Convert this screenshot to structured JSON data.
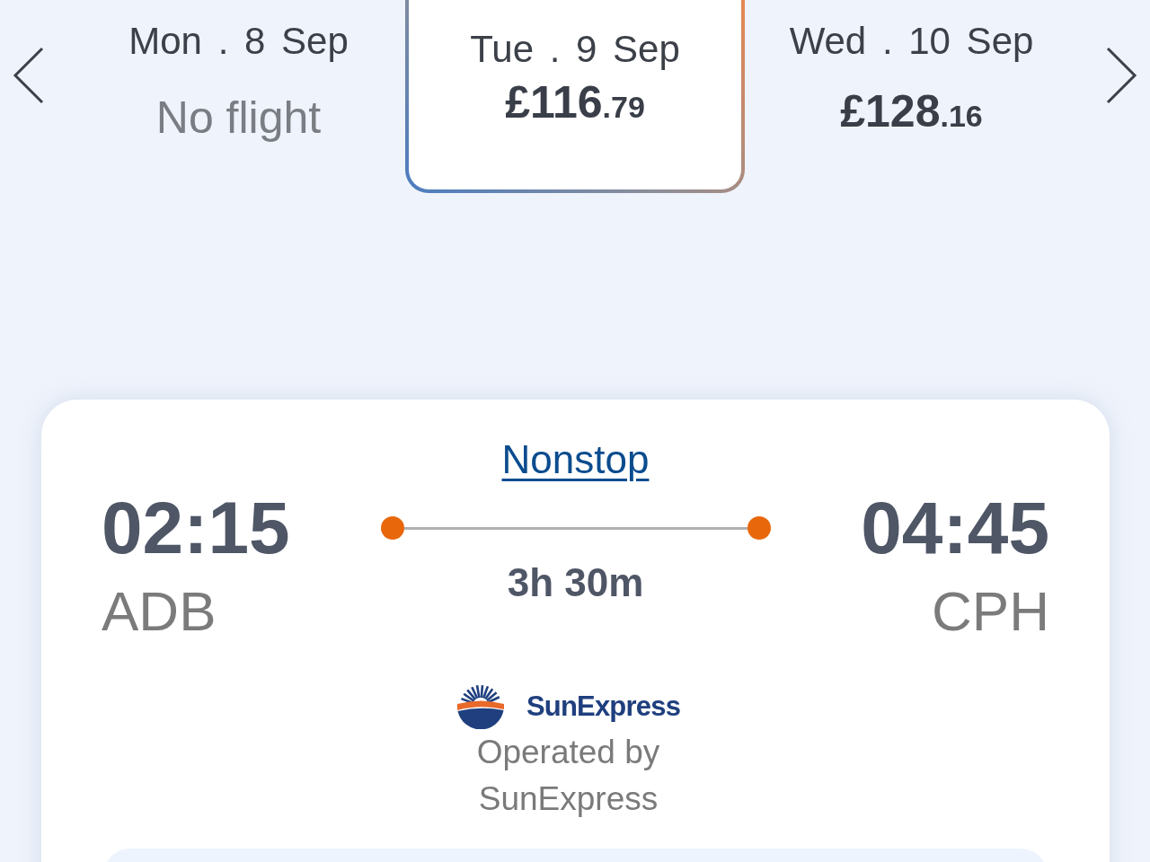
{
  "date_selector": {
    "dates": [
      {
        "label": "Mon . 8 Sep",
        "kind": "no_flight",
        "note": "No flight",
        "selected": false
      },
      {
        "label": "Tue . 9 Sep",
        "kind": "price",
        "price_whole": "£116",
        "price_fraction": ".79",
        "selected": true
      },
      {
        "label": "Wed . 10 Sep",
        "kind": "price",
        "price_whole": "£128",
        "price_fraction": ".16",
        "selected": false
      }
    ]
  },
  "flight": {
    "stops_link": "Nonstop",
    "departure": {
      "time": "02:15",
      "airport": "ADB"
    },
    "duration": "3h 30m",
    "arrival": {
      "time": "04:45",
      "airport": "CPH"
    },
    "airline": {
      "wordmark": "SunExpress",
      "operated_by": "Operated by SunExpress"
    }
  }
}
